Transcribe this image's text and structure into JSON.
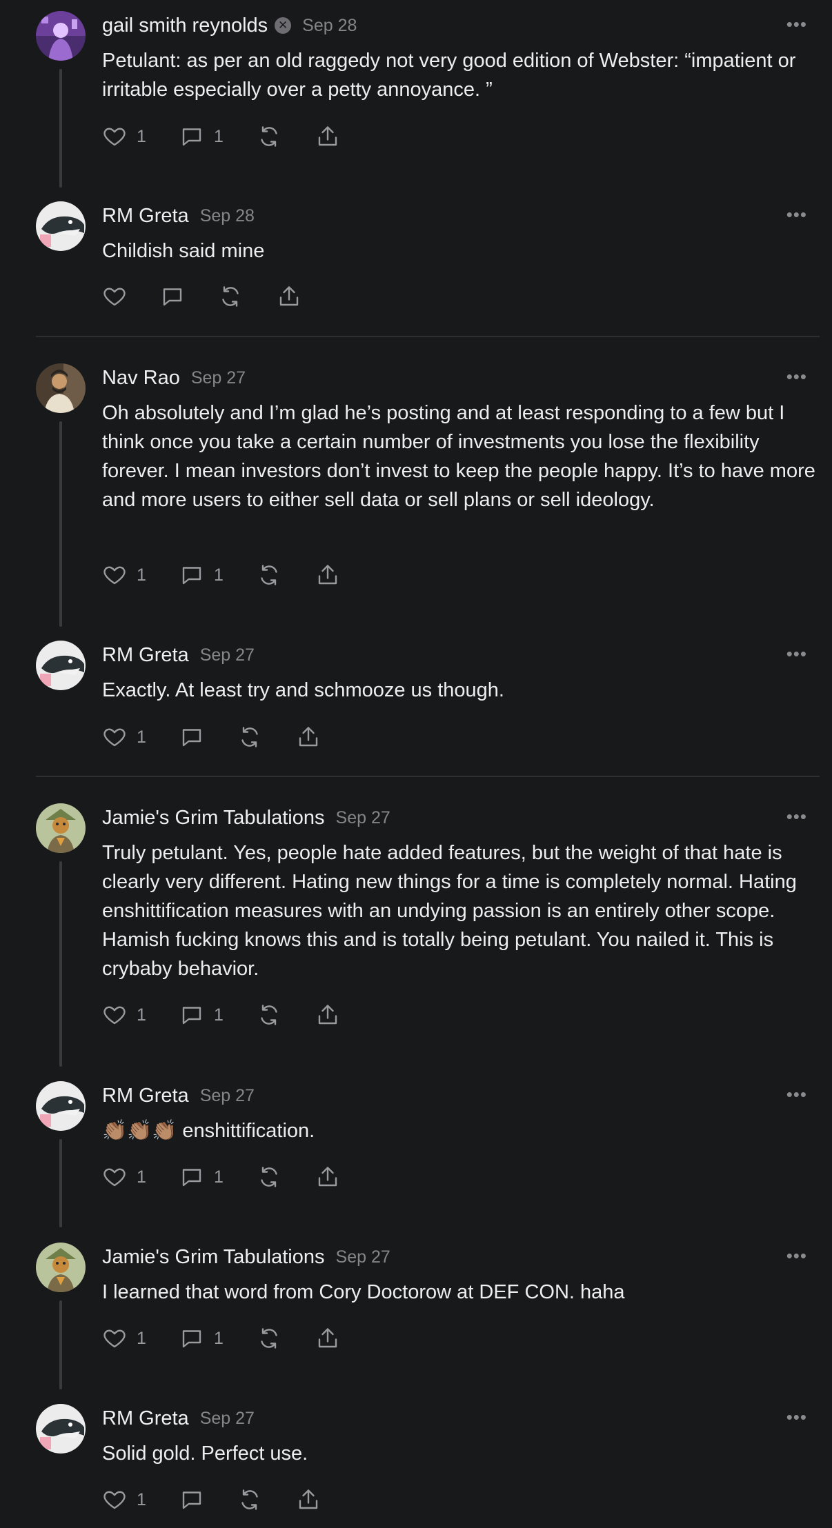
{
  "comments": [
    {
      "author": "gail smith reynolds",
      "badge": "✕",
      "date": "Sep 28",
      "text": "Petulant: as per an old raggedy not very good edition of Webster: “impatient or irritable especially over a petty annoyance. ”",
      "likes": "1",
      "replies": "1",
      "avatar": "purple-figure-avatar",
      "colors": {
        "bg": "#5b3a8a",
        "fg": "#e6c7ff"
      }
    },
    {
      "author": "RM Greta",
      "date": "Sep 28",
      "text": "Childish said mine",
      "likes": "",
      "replies": "",
      "avatar": "bird-avatar",
      "colors": {
        "bg": "#e9e9ea",
        "fg": "#2d3437"
      }
    },
    {
      "author": "Nav Rao",
      "date": "Sep 27",
      "text": "Oh absolutely and I’m glad he’s posting and at least responding to a few but I think once you take a certain number of investments you lose the flexibility forever. I mean investors don’t invest to keep the people happy. It’s to have more and more users to either sell data or sell plans or sell ideology.",
      "likes": "1",
      "replies": "1",
      "avatar": "man-portrait-avatar",
      "colors": {
        "bg": "#5a4a3a",
        "fg": "#d9b48a"
      }
    },
    {
      "author": "RM Greta",
      "date": "Sep 27",
      "text": "Exactly. At least try and schmooze us though.",
      "likes": "1",
      "replies": "",
      "avatar": "bird-avatar",
      "colors": {
        "bg": "#e9e9ea",
        "fg": "#2d3437"
      }
    },
    {
      "author": "Jamie's Grim Tabulations",
      "date": "Sep 27",
      "text": "Truly petulant. Yes, people hate added features, but the weight of that hate is clearly very different. Hating new things for a time is completely normal. Hating enshittification measures with an undying passion is an entirely other scope. Hamish fucking knows this and is totally being petulant. You nailed it. This is crybaby behavior.",
      "likes": "1",
      "replies": "1",
      "avatar": "cartoon-character-avatar",
      "colors": {
        "bg": "#b7c39a",
        "fg": "#8a6a3c"
      }
    },
    {
      "author": "RM Greta",
      "date": "Sep 27",
      "text": "👏🏽👏🏽👏🏽 enshittification.",
      "likes": "1",
      "replies": "1",
      "avatar": "bird-avatar",
      "colors": {
        "bg": "#e9e9ea",
        "fg": "#2d3437"
      }
    },
    {
      "author": "Jamie's Grim Tabulations",
      "date": "Sep 27",
      "text": "I learned that word from Cory Doctorow at DEF CON. haha",
      "likes": "1",
      "replies": "1",
      "avatar": "cartoon-character-avatar",
      "colors": {
        "bg": "#b7c39a",
        "fg": "#8a6a3c"
      }
    },
    {
      "author": "RM Greta",
      "date": "Sep 27",
      "text": "Solid gold. Perfect use.",
      "likes": "1",
      "replies": "",
      "avatar": "bird-avatar",
      "colors": {
        "bg": "#e9e9ea",
        "fg": "#2d3437"
      }
    }
  ],
  "more_label": "•••"
}
